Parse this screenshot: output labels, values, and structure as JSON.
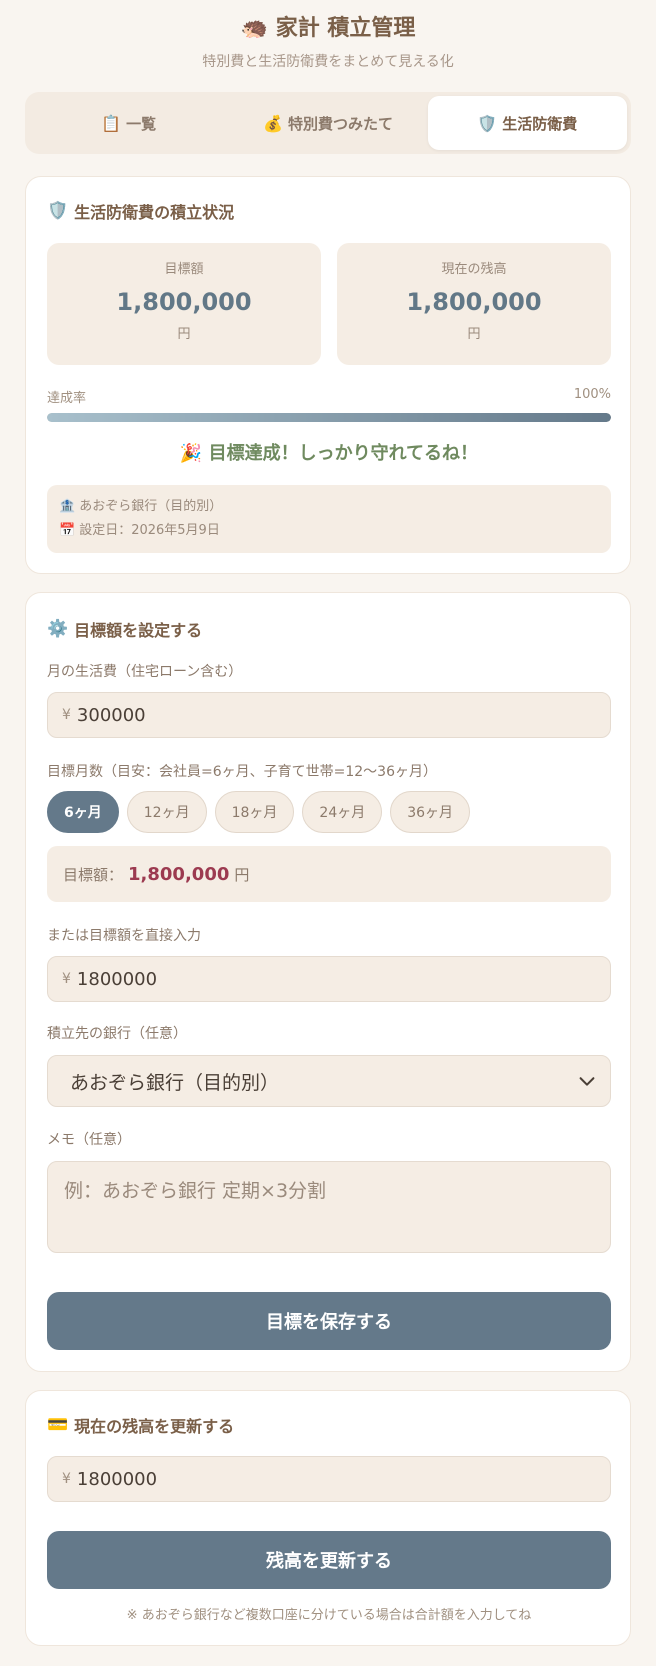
{
  "header": {
    "title_icon": "hedgehog-icon",
    "title": "🦔 家計 積立管理",
    "subtitle": "特別費と生活防衛費をまとめて見える化"
  },
  "tabs": [
    {
      "icon": "clipboard-icon",
      "glyph": "📋",
      "label": "一覧",
      "active": false
    },
    {
      "icon": "money-bag-icon",
      "glyph": "💰",
      "label": "特別費つみたて",
      "active": false
    },
    {
      "icon": "shield-icon",
      "glyph": "🛡️",
      "label": "生活防衛費",
      "active": true
    }
  ],
  "status_card": {
    "title_glyph": "🛡️",
    "title": "生活防衛費の積立状況",
    "target_label": "目標額",
    "target_value": "1,800,000",
    "target_unit": "円",
    "balance_label": "現在の残高",
    "balance_value": "1,800,000",
    "balance_unit": "円",
    "rate_label": "達成率",
    "rate_value": "100%",
    "progress": 1.0,
    "achieved_message": "🎉 目標達成！しっかり守れてるね！",
    "bank_glyph": "🏦",
    "bank": "あおぞら銀行（目的別）",
    "date_glyph": "📅",
    "date": "設定日：2026年5月9日"
  },
  "goal_card": {
    "title_glyph": "⚙️",
    "title": "目標額を設定する",
    "monthly_label": "月の生活費（住宅ローン含む）",
    "currency": "¥",
    "monthly_value": "300000",
    "months_label": "目標月数（目安：会社員=6ヶ月、子育て世帯=12〜36ヶ月）",
    "months": [
      {
        "label": "6ヶ月",
        "active": true
      },
      {
        "label": "12ヶ月",
        "active": false
      },
      {
        "label": "18ヶ月",
        "active": false
      },
      {
        "label": "24ヶ月",
        "active": false
      },
      {
        "label": "36ヶ月",
        "active": false
      }
    ],
    "target_prefix": "目標額：",
    "target_amount": "1,800,000",
    "target_suffix": "円",
    "direct_label": "または目標額を直接入力",
    "direct_value": "1800000",
    "bank_label": "積立先の銀行（任意）",
    "bank_selected": "あおぞら銀行（目的別）",
    "memo_label": "メモ（任意）",
    "memo_placeholder": "例：あおぞら銀行 定期×3分割",
    "save_button": "目標を保存する"
  },
  "balance_card": {
    "title_glyph": "💳",
    "title": "現在の残高を更新する",
    "currency": "¥",
    "balance_value": "1800000",
    "update_button": "残高を更新する",
    "note": "※ あおぞら銀行など複数口座に分けている場合は合計額を入力してね"
  }
}
